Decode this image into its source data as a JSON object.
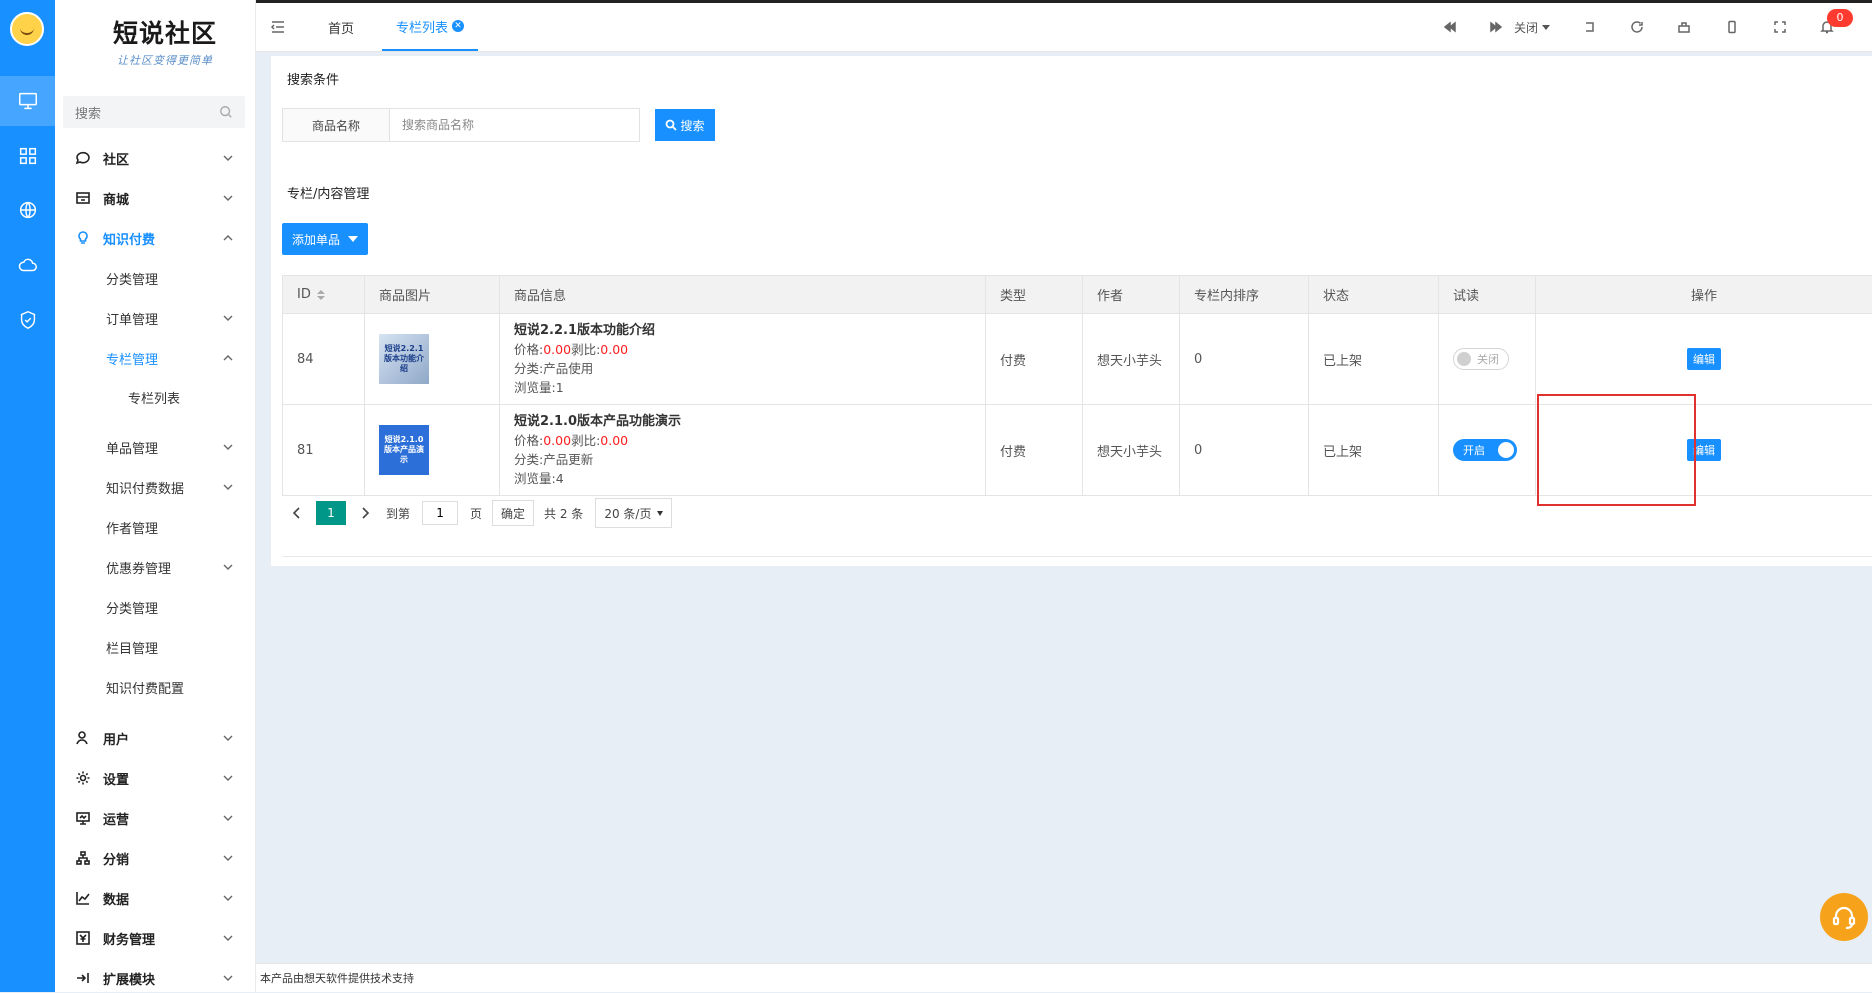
{
  "brand": {
    "title": "短说社区",
    "slogan": "让社区变得更简单"
  },
  "sidebar": {
    "search_placeholder": "搜索",
    "menu": [
      {
        "label": "社区",
        "icon": "chat-icon"
      },
      {
        "label": "商城",
        "icon": "store-icon"
      },
      {
        "label": "知识付费",
        "icon": "lightbulb-icon"
      }
    ],
    "knowledge_sub": [
      "分类管理",
      "订单管理",
      "专栏管理",
      "专栏列表",
      "单品管理",
      "知识付费数据",
      "作者管理",
      "优惠券管理",
      "分类管理",
      "栏目管理",
      "知识付费配置"
    ],
    "menu_bottom": [
      {
        "label": "用户",
        "icon": "user-icon"
      },
      {
        "label": "设置",
        "icon": "gear-icon"
      },
      {
        "label": "运营",
        "icon": "monitor-icon"
      },
      {
        "label": "分销",
        "icon": "network-icon"
      },
      {
        "label": "数据",
        "icon": "chart-icon"
      },
      {
        "label": "财务管理",
        "icon": "yuan-icon"
      },
      {
        "label": "扩展模块",
        "icon": "extend-icon"
      }
    ]
  },
  "header": {
    "tabs": [
      "首页",
      "专栏列表"
    ],
    "close_label": "关闭",
    "notification_count": "0"
  },
  "search": {
    "section_title": "搜索条件",
    "field_label": "商品名称",
    "placeholder": "搜索商品名称",
    "button_label": "搜索"
  },
  "list": {
    "section_title": "专栏/内容管理",
    "add_button": "添加单品",
    "columns": [
      "ID",
      "商品图片",
      "商品信息",
      "类型",
      "作者",
      "专栏内排序",
      "状态",
      "试读",
      "操作"
    ],
    "rows": [
      {
        "id": "84",
        "thumb_text": "短说2.2.1版本功能介绍",
        "title": "短说2.2.1版本功能介绍",
        "price_label": "价格:",
        "price": "0.00",
        "ratio_label": "剥比:",
        "ratio": "0.00",
        "category": "分类:产品使用",
        "views": "浏览量:1",
        "type": "付费",
        "author": "想天小芋头",
        "sort": "0",
        "status": "已上架",
        "trial": "关闭",
        "trial_on": false,
        "action": "编辑"
      },
      {
        "id": "81",
        "thumb_text": "短说2.1.0版本产品演示",
        "title": "短说2.1.0版本产品功能演示",
        "price_label": "价格:",
        "price": "0.00",
        "ratio_label": "剥比:",
        "ratio": "0.00",
        "category": "分类:产品更新",
        "views": "浏览量:4",
        "type": "付费",
        "author": "想天小芋头",
        "sort": "0",
        "status": "已上架",
        "trial": "开启",
        "trial_on": true,
        "action": "编辑"
      }
    ]
  },
  "pagination": {
    "current": "1",
    "goto_label": "到第",
    "goto_value": "1",
    "page_unit": "页",
    "confirm": "确定",
    "total": "共 2 条",
    "page_size": "20 条/页"
  },
  "footer": {
    "text": "本产品由想天软件提供技术支持"
  },
  "colors": {
    "primary": "#1890ff",
    "price_red": "#ff1e1e",
    "pager_active": "#009688",
    "highlight": "#e03030"
  }
}
